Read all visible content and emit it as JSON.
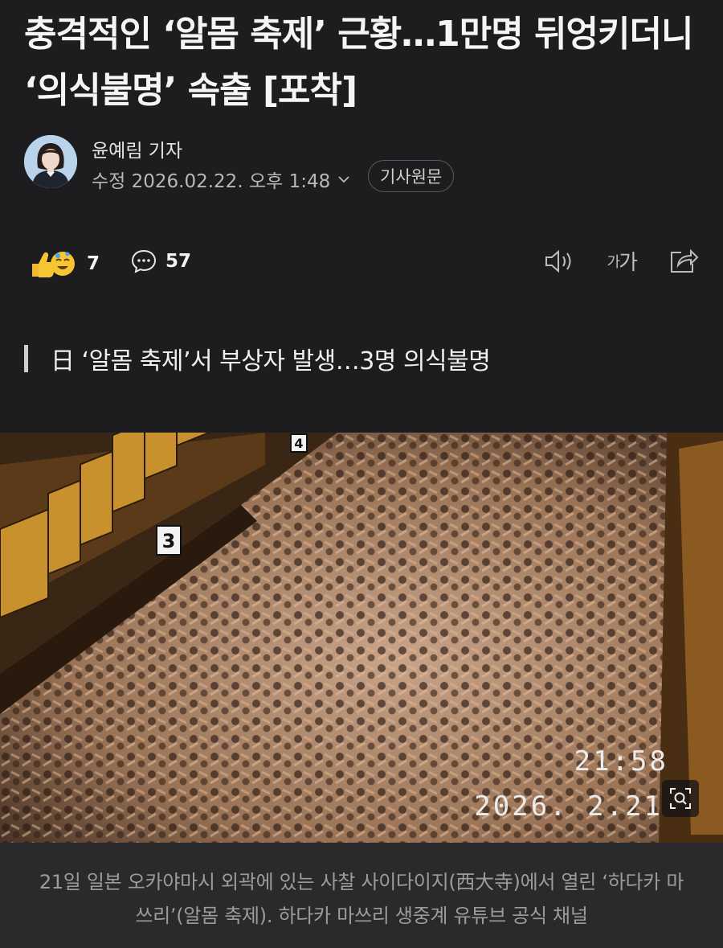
{
  "article": {
    "headline": "충격적인 ‘알몸 축제’ 근황…1만명 뒤엉키더니 ‘의식불명’ 속출 [포착]",
    "author": "윤예림 기자",
    "timestamp": "수정 2026.02.22. 오후 1:48",
    "original_button": "기사원문",
    "subheading": "日 ‘알몸 축제’서 부상자 발생…3명 의식불명",
    "caption": "21일 일본 오카야마시 외곽에 있는 사찰 사이다이지(西大寺)에서 열린 ‘하다카 마쓰리’(알몸 축제). 하다카 마쓰리 생중계 유튜브 공식 채널"
  },
  "actions": {
    "reaction_count": "7",
    "comment_count": "57",
    "font_size_label_small": "가",
    "font_size_label_large": "가"
  },
  "photo": {
    "timestamp_time": "21:58",
    "timestamp_date": "2026. 2.21",
    "sign_number_3": "3",
    "sign_number_4": "4"
  },
  "icons": [
    "like-emoji-icon",
    "smile-emoji-icon",
    "comment-icon",
    "speaker-icon",
    "font-size-icon",
    "share-icon",
    "chevron-down-icon",
    "zoom-icon"
  ],
  "colors": {
    "background": "#1d1d1f",
    "caption_bg": "#2a2a2c",
    "text": "#f2f2f2",
    "muted": "#b8b8b8"
  }
}
